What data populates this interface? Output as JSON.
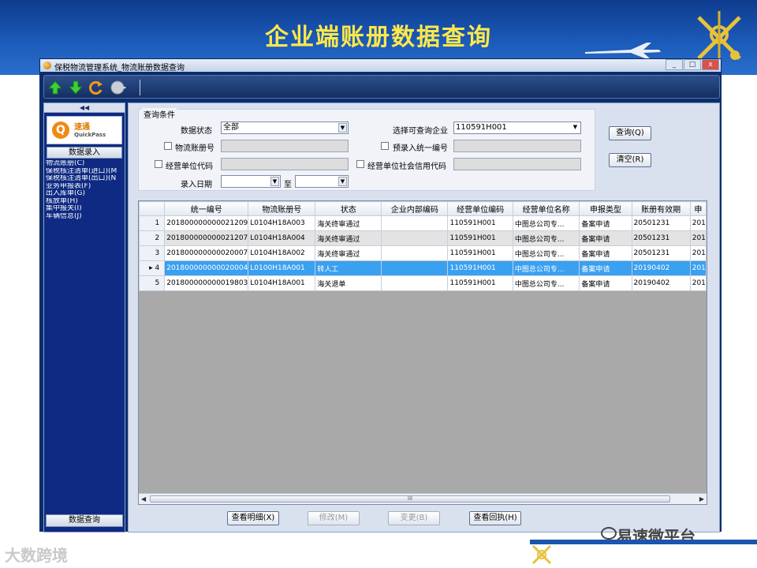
{
  "slide": {
    "title": "企业端账册数据查询"
  },
  "window": {
    "title": "保税物流管理系统_物流账册数据查询",
    "buttons": [
      "_",
      "□",
      "x"
    ]
  },
  "toolbar": {
    "icons": [
      "up-arrow-icon",
      "down-arrow-icon",
      "refresh-icon",
      "globe-icon"
    ]
  },
  "sidebar": {
    "collapse": "◀◀",
    "logo_cn": "速通",
    "logo_en": "QuickPass",
    "group_label": "数据录入",
    "items": [
      "物流账册(C)",
      "保税核注清单(进口)(M",
      "保税核注清单(出口)(N",
      "业务申报表(F)",
      "出入库单(G)",
      "核放单(H)",
      "集中报关(I)",
      "车辆信息(J)"
    ],
    "bottom_label": "数据查询"
  },
  "criteria": {
    "title": "查询条件",
    "data_status_label": "数据状态",
    "data_status_value": "全部",
    "select_company_label": "选择可查询企业",
    "select_company_value": "110591H001",
    "logistics_book_label": "物流账册号",
    "preentry_label": "预录入统一编号",
    "operator_code_label": "经营单位代码",
    "operator_credit_label": "经营单位社会信用代码",
    "entry_date_label": "录入日期",
    "to_label": "至"
  },
  "actions": {
    "query": "查询(Q)",
    "clear": "清空(R)",
    "view_detail": "查看明细(X)",
    "modify": "修改(M)",
    "change": "变更(B)",
    "view_receipt": "查看回执(H)"
  },
  "grid": {
    "columns": [
      "",
      "统一编号",
      "物流账册号",
      "状态",
      "企业内部编码",
      "经营单位编码",
      "经营单位名称",
      "申报类型",
      "账册有效期",
      "申"
    ],
    "rows": [
      {
        "num": "1",
        "cells": [
          "201800000000021209",
          "L0104H18A003",
          "海关终审通过",
          "",
          "110591H001",
          "中图总公司专...",
          "备案申请",
          "20501231",
          "201"
        ]
      },
      {
        "num": "2",
        "cells": [
          "201800000000021207",
          "L0104H18A004",
          "海关终审通过",
          "",
          "110591H001",
          "中图总公司专...",
          "备案申请",
          "20501231",
          "201"
        ]
      },
      {
        "num": "3",
        "cells": [
          "201800000000020007",
          "L0104H18A002",
          "海关终审通过",
          "",
          "110591H001",
          "中图总公司专...",
          "备案申请",
          "20501231",
          "201"
        ]
      },
      {
        "num": "4",
        "cells": [
          "201800000000020004",
          "L0100H18A001",
          "转人工",
          "",
          "110591H001",
          "中图总公司专...",
          "备案申请",
          "20190402",
          "201"
        ]
      },
      {
        "num": "5",
        "cells": [
          "201800000000019803",
          "L0104H18A001",
          "海关退单",
          "",
          "110591H001",
          "中图总公司专...",
          "备案申请",
          "20190402",
          "201"
        ]
      }
    ],
    "selected_row": 4,
    "scroll_thumb_label": "III"
  },
  "watermarks": {
    "left": "大数跨境",
    "right": "易速微平台"
  },
  "colors": {
    "banner": "#1b5ab8",
    "title": "#ffe84a",
    "selected_row": "#3aa0f0"
  }
}
